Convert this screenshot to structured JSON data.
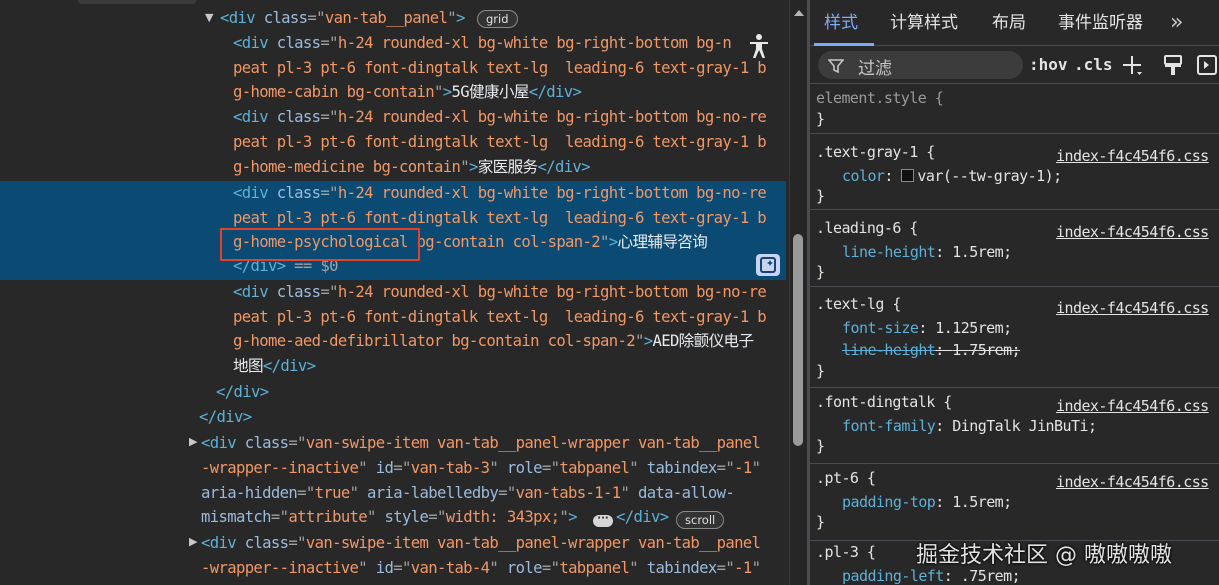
{
  "elements": {
    "lines": [
      {
        "segments": [
          [
            "tag",
            "<div "
          ],
          [
            "an",
            "class"
          ],
          [
            "pu",
            "=\""
          ],
          [
            "av",
            "van-tab__panel"
          ],
          [
            "pu",
            "\""
          ],
          [
            "tag",
            ">"
          ]
        ]
      },
      {
        "segments": [
          [
            "tag",
            "<div "
          ],
          [
            "an",
            "class"
          ],
          [
            "pu",
            "=\""
          ],
          [
            "av",
            "h-24 rounded-xl bg-white bg-right-bottom bg-n"
          ]
        ]
      },
      {
        "segments": [
          [
            "av",
            "peat pl-3 pt-6 font-dingtalk text-lg  leading-6 text-gray-1 b"
          ]
        ]
      },
      {
        "segments": [
          [
            "av",
            "g-home-cabin bg-contain"
          ],
          [
            "pu",
            "\""
          ],
          [
            "tag",
            ">"
          ],
          [
            "tx",
            "5G健康小屋"
          ],
          [
            "tag",
            "</div>"
          ]
        ]
      },
      {
        "segments": [
          [
            "tag",
            "<div "
          ],
          [
            "an",
            "class"
          ],
          [
            "pu",
            "=\""
          ],
          [
            "av",
            "h-24 rounded-xl bg-white bg-right-bottom bg-no-re"
          ]
        ]
      },
      {
        "segments": [
          [
            "av",
            "peat pl-3 pt-6 font-dingtalk text-lg  leading-6 text-gray-1 b"
          ]
        ]
      },
      {
        "segments": [
          [
            "av",
            "g-home-medicine bg-contain"
          ],
          [
            "pu",
            "\""
          ],
          [
            "tag",
            ">"
          ],
          [
            "tx",
            "家医服务"
          ],
          [
            "tag",
            "</div>"
          ]
        ]
      },
      {
        "segments": [
          [
            "tag",
            "<div "
          ],
          [
            "an",
            "class"
          ],
          [
            "pu",
            "=\""
          ],
          [
            "av",
            "h-24 rounded-xl bg-white bg-right-bottom bg-no-re"
          ]
        ]
      },
      {
        "segments": [
          [
            "av",
            "peat pl-3 pt-6 font-dingtalk text-lg  leading-6 text-gray-1 b"
          ]
        ]
      },
      {
        "segments": [
          [
            "av",
            "g-home-psychological bg-contain col-span-2"
          ],
          [
            "pu",
            "\""
          ],
          [
            "tag",
            ">"
          ],
          [
            "tx",
            "心理辅导咨询"
          ]
        ]
      },
      {
        "segments": [
          [
            "tag",
            "</div>"
          ],
          [
            "pu",
            " == "
          ],
          [
            "pu",
            "$0"
          ]
        ]
      },
      {
        "segments": [
          [
            "tag",
            "<div "
          ],
          [
            "an",
            "class"
          ],
          [
            "pu",
            "=\""
          ],
          [
            "av",
            "h-24 rounded-xl bg-white bg-right-bottom bg-no-re"
          ]
        ]
      },
      {
        "segments": [
          [
            "av",
            "peat pl-3 pt-6 font-dingtalk text-lg  leading-6 text-gray-1 b"
          ]
        ]
      },
      {
        "segments": [
          [
            "av",
            "g-home-aed-defibrillator bg-contain col-span-2"
          ],
          [
            "pu",
            "\""
          ],
          [
            "tag",
            ">"
          ],
          [
            "tx",
            "AED除颤仪电子"
          ]
        ]
      },
      {
        "segments": [
          [
            "tx",
            "地图"
          ],
          [
            "tag",
            "</div>"
          ]
        ]
      },
      {
        "segments": [
          [
            "tag",
            "</div>"
          ]
        ]
      },
      {
        "segments": [
          [
            "tag",
            "</div>"
          ]
        ]
      },
      {
        "segments": [
          [
            "tag",
            "<div "
          ],
          [
            "an",
            "class"
          ],
          [
            "pu",
            "=\""
          ],
          [
            "av",
            "van-swipe-item van-tab__panel-wrapper van-tab__panel"
          ]
        ]
      },
      {
        "segments": [
          [
            "av",
            "-wrapper--inactive"
          ],
          [
            "pu",
            "\" "
          ],
          [
            "an",
            "id"
          ],
          [
            "pu",
            "=\""
          ],
          [
            "av",
            "van-tab-3"
          ],
          [
            "pu",
            "\" "
          ],
          [
            "an",
            "role"
          ],
          [
            "pu",
            "=\""
          ],
          [
            "av",
            "tabpanel"
          ],
          [
            "pu",
            "\" "
          ],
          [
            "an",
            "tabindex"
          ],
          [
            "pu",
            "=\""
          ],
          [
            "av",
            "-1"
          ],
          [
            "pu",
            "\""
          ]
        ]
      },
      {
        "segments": [
          [
            "an",
            "aria-hidden"
          ],
          [
            "pu",
            "=\""
          ],
          [
            "av",
            "true"
          ],
          [
            "pu",
            "\" "
          ],
          [
            "an",
            "aria-labelledby"
          ],
          [
            "pu",
            "=\""
          ],
          [
            "av",
            "van-tabs-1-1"
          ],
          [
            "pu",
            "\" "
          ],
          [
            "an",
            "data-allow-"
          ]
        ]
      },
      {
        "segments": [
          [
            "an",
            "mismatch"
          ],
          [
            "pu",
            "=\""
          ],
          [
            "av",
            "attribute"
          ],
          [
            "pu",
            "\" "
          ],
          [
            "an",
            "style"
          ],
          [
            "pu",
            "=\""
          ],
          [
            "av",
            "width: 343px;"
          ],
          [
            "pu",
            "\""
          ],
          [
            "tag",
            ">"
          ]
        ]
      },
      {
        "segments": [
          [
            "tag",
            "<div "
          ],
          [
            "an",
            "class"
          ],
          [
            "pu",
            "=\""
          ],
          [
            "av",
            "van-swipe-item van-tab__panel-wrapper van-tab__panel"
          ]
        ]
      },
      {
        "segments": [
          [
            "av",
            "-wrapper--inactive"
          ],
          [
            "pu",
            "\" "
          ],
          [
            "an",
            "id"
          ],
          [
            "pu",
            "=\""
          ],
          [
            "av",
            "van-tab-4"
          ],
          [
            "pu",
            "\" "
          ],
          [
            "an",
            "role"
          ],
          [
            "pu",
            "=\""
          ],
          [
            "av",
            "tabpanel"
          ],
          [
            "pu",
            "\" "
          ],
          [
            "an",
            "tabindex"
          ],
          [
            "pu",
            "=\""
          ],
          [
            "av",
            "-1"
          ],
          [
            "pu",
            "\""
          ]
        ]
      }
    ],
    "badges": {
      "grid": "grid",
      "scroll": "scroll"
    },
    "ellipsis": "···",
    "closing_after_ellipsis": "</div>"
  },
  "styles_panel": {
    "tabs": [
      "样式",
      "计算样式",
      "布局",
      "事件监听器"
    ],
    "active_tab": "样式",
    "more": "»",
    "filter_placeholder": "过滤",
    "hov": ":hov",
    "cls": ".cls",
    "rules": [
      {
        "selector": "element.style {",
        "source": "",
        "decls": [],
        "close": "}"
      },
      {
        "selector": ".text-gray-1 {",
        "source": "index-f4c454f6.css",
        "decls": [
          {
            "prop": "color",
            "value": "var(--tw-gray-1);",
            "swatch": true,
            "struck": false
          }
        ],
        "close": "}"
      },
      {
        "selector": ".leading-6 {",
        "source": "index-f4c454f6.css",
        "decls": [
          {
            "prop": "line-height",
            "value": "1.5rem;",
            "swatch": false,
            "struck": false
          }
        ],
        "close": "}"
      },
      {
        "selector": ".text-lg {",
        "source": "index-f4c454f6.css",
        "decls": [
          {
            "prop": "font-size",
            "value": "1.125rem;",
            "swatch": false,
            "struck": false
          },
          {
            "prop": "line-height",
            "value": "1.75rem;",
            "swatch": false,
            "struck": true
          }
        ],
        "close": "}"
      },
      {
        "selector": ".font-dingtalk {",
        "source": "index-f4c454f6.css",
        "decls": [
          {
            "prop": "font-family",
            "value": "DingTalk JinBuTi;",
            "swatch": false,
            "struck": false
          }
        ],
        "close": "}"
      },
      {
        "selector": ".pt-6 {",
        "source": "index-f4c454f6.css",
        "decls": [
          {
            "prop": "padding-top",
            "value": "1.5rem;",
            "swatch": false,
            "struck": false
          }
        ],
        "close": "}"
      },
      {
        "selector": ".pl-3 {",
        "source": "",
        "decls": [
          {
            "prop": "padding-left",
            "value": ".75rem;",
            "swatch": false,
            "struck": false
          }
        ],
        "close": ""
      }
    ],
    "swatch_color": "#0f0f10"
  },
  "watermark": "掘金技术社区 @ 嗷嗷嗷嗷",
  "colors": {
    "selected_row": "#0a4a73",
    "highlight": "#e0432a",
    "accent_tab": "#7cacf8"
  }
}
